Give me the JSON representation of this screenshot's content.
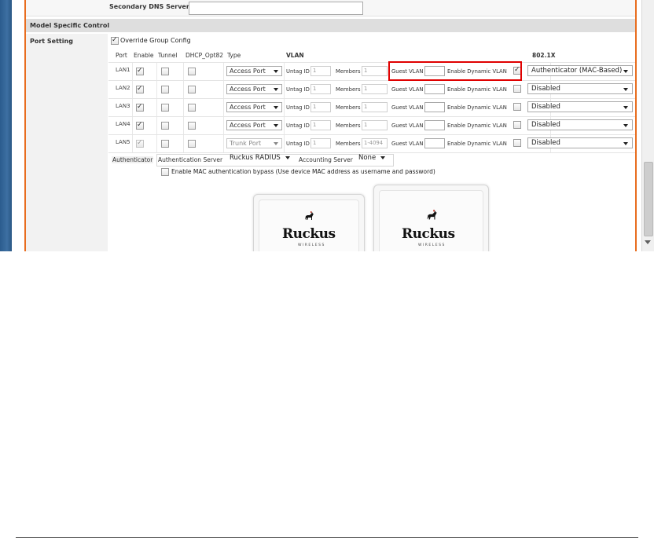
{
  "dns": {
    "label": "Secondary DNS Server",
    "value": ""
  },
  "section": {
    "title": "Model Specific Control"
  },
  "port_setting": {
    "label": "Port Setting",
    "override_label": "Override Group Config",
    "override_checked": true
  },
  "columns": {
    "port": "Port",
    "enable": "Enable",
    "tunnel": "Tunnel",
    "dhcp": "DHCP_Opt82",
    "type": "Type",
    "vlan": "VLAN",
    "dot1x": "802.1X"
  },
  "vlan_labels": {
    "untag": "Untag ID",
    "members": "Members",
    "guest": "Guest VLAN",
    "dynamic": "Enable Dynamic VLAN"
  },
  "ports": [
    {
      "name": "LAN1",
      "enable": true,
      "tunnel": false,
      "dhcp": false,
      "type": "Access Port",
      "untag": "1",
      "members": "1",
      "guest": "",
      "dynamic": true,
      "dot1x": "Authenticator (MAC-Based)",
      "disabled": false
    },
    {
      "name": "LAN2",
      "enable": true,
      "tunnel": false,
      "dhcp": false,
      "type": "Access Port",
      "untag": "1",
      "members": "1",
      "guest": "",
      "dynamic": false,
      "dot1x": "Disabled",
      "disabled": false
    },
    {
      "name": "LAN3",
      "enable": true,
      "tunnel": false,
      "dhcp": false,
      "type": "Access Port",
      "untag": "1",
      "members": "1",
      "guest": "",
      "dynamic": false,
      "dot1x": "Disabled",
      "disabled": false
    },
    {
      "name": "LAN4",
      "enable": true,
      "tunnel": false,
      "dhcp": false,
      "type": "Access Port",
      "untag": "1",
      "members": "1",
      "guest": "",
      "dynamic": false,
      "dot1x": "Disabled",
      "disabled": false
    },
    {
      "name": "LAN5",
      "enable": true,
      "tunnel": false,
      "dhcp": false,
      "type": "Trunk Port",
      "untag": "1",
      "members": "1-4094",
      "guest": "",
      "dynamic": false,
      "dot1x": "Disabled",
      "disabled": true
    }
  ],
  "authenticator": {
    "label": "Authenticator",
    "auth_server_label": "Authentication Server",
    "auth_server_value": "Ruckus RADIUS",
    "acct_server_label": "Accounting Server",
    "acct_server_value": "None",
    "mac_bypass_label": "Enable MAC authentication bypass (Use device MAC address as username and password)",
    "mac_bypass_checked": false
  },
  "devices": {
    "brand": "Ruckus",
    "sub": "WIRELESS"
  }
}
